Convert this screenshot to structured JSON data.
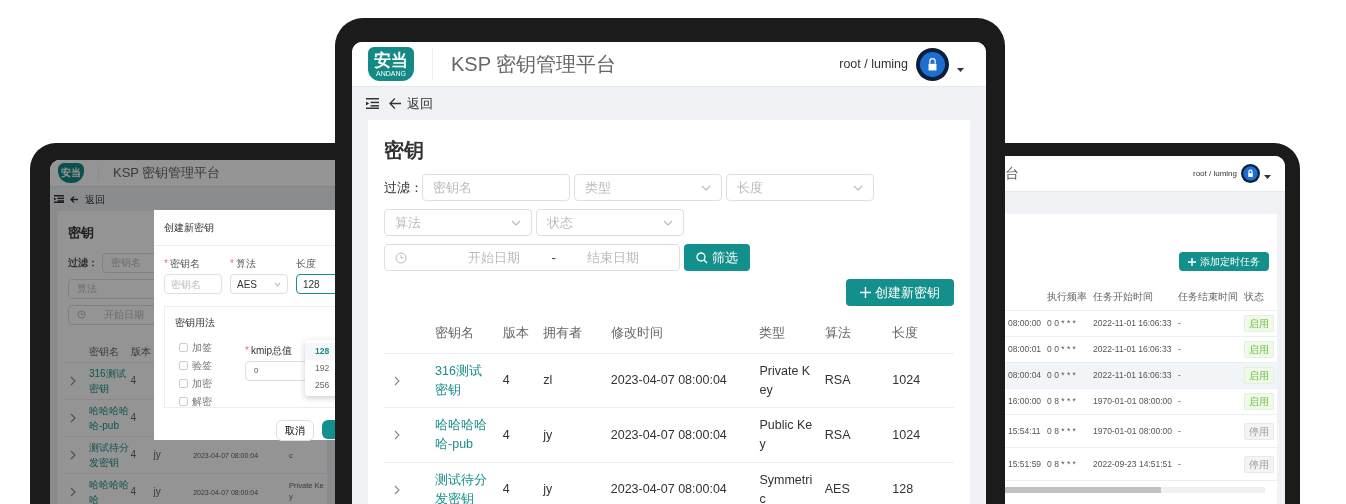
{
  "left_tablet": {
    "logo": "安当",
    "title": "KSP 密钥管理平台",
    "back": "返回",
    "page_title": "密钥",
    "filter_label": "过滤：",
    "name_filter": {
      "placeholder": "密钥名"
    },
    "algorithm_filter": {
      "placeholder": "算法"
    },
    "date_filter": {
      "placeholder": "开始日期"
    },
    "table": {
      "columns": [
        "密钥名",
        "版本"
      ],
      "rows": [
        {
          "name": "316测试密钥",
          "version": "4"
        },
        {
          "name": "哈哈哈哈哈-pub",
          "version": "4"
        },
        {
          "name": "测试待分发密钥",
          "version": "4",
          "owner": "jy",
          "modified": "2023-04-07 08:00:04",
          "type": "c"
        },
        {
          "name": "哈哈哈哈哈",
          "version": "4",
          "owner": "jy",
          "modified": "2023-04-07 08:00:04",
          "type": "Private Key"
        }
      ]
    },
    "dialog": {
      "title": "创建新密钥",
      "fields": [
        {
          "label": "密钥名",
          "required_mark": "*",
          "placeholder": "密钥名"
        },
        {
          "label": "算法",
          "required_mark": "*",
          "value": "AES"
        },
        {
          "label": "长度",
          "value": "128"
        }
      ],
      "length_options": [
        {
          "label": "128",
          "selected": true
        },
        {
          "label": "192",
          "selected": false
        },
        {
          "label": "256",
          "selected": false
        }
      ],
      "usage_title": "密钥用法",
      "usages": [
        {
          "label": "加签",
          "checked": false
        },
        {
          "label": "验签",
          "checked": false
        },
        {
          "label": "加密",
          "checked": false
        },
        {
          "label": "解密",
          "checked": false
        }
      ],
      "kmip": {
        "label": "kmip总值",
        "required_mark": "*",
        "value": "0"
      },
      "cancel": "取消"
    }
  },
  "main_tablet": {
    "logo": "安当",
    "logo_caption": "ANDANG",
    "title": "KSP 密钥管理平台",
    "user": "root / luming",
    "back": "返回",
    "page_title": "密钥",
    "filter_label": "过滤：",
    "filters": [
      {
        "kind": "input",
        "placeholder": "密钥名"
      },
      {
        "kind": "select",
        "placeholder": "类型"
      },
      {
        "kind": "select",
        "placeholder": "长度"
      },
      {
        "kind": "select",
        "placeholder": "算法"
      },
      {
        "kind": "select",
        "placeholder": "状态"
      }
    ],
    "date_range": {
      "start": "开始日期",
      "separator": "-",
      "end": "结束日期"
    },
    "search_button": "筛选",
    "create_button": "创建新密钥",
    "table": {
      "columns": [
        "密钥名",
        "版本",
        "拥有者",
        "修改时间",
        "类型",
        "算法",
        "长度"
      ],
      "rows": [
        {
          "name": "316测试密钥",
          "version": "4",
          "owner": "zl",
          "modified": "2023-04-07 08:00:04",
          "type": "Private Key",
          "algorithm": "RSA",
          "length": "1024"
        },
        {
          "name": "哈哈哈哈哈-pub",
          "version": "4",
          "owner": "jy",
          "modified": "2023-04-07 08:00:04",
          "type": "Public Key",
          "algorithm": "RSA",
          "length": "1024"
        },
        {
          "name": "测试待分发密钥",
          "version": "4",
          "owner": "jy",
          "modified": "2023-04-07 08:00:04",
          "type": "Symmetric",
          "algorithm": "AES",
          "length": "128"
        }
      ]
    }
  },
  "right_tablet": {
    "title": "台",
    "user": "root / luming",
    "add_button": "添加定时任务",
    "table": {
      "columns": [
        "执行频率",
        "任务开始时间",
        "任务结束时间",
        "状态"
      ],
      "rows": [
        {
          "column_1": "08:00:00",
          "frequency": "0 0 * * *",
          "start": "2022-11-01 16:06:33",
          "end": "-",
          "status": "启用",
          "enabled": true,
          "highlighted": false
        },
        {
          "column_1": "08:00:01",
          "frequency": "0 0 * * *",
          "start": "2022-11-01 16:06:33",
          "end": "-",
          "status": "启用",
          "enabled": true,
          "highlighted": false
        },
        {
          "column_1": "08:00:04",
          "frequency": "0 0 * * *",
          "start": "2022-11-01 16:06:33",
          "end": "-",
          "status": "启用",
          "enabled": true,
          "highlighted": true
        },
        {
          "column_1": "16:00:00",
          "frequency": "0 8 * * *",
          "start": "1970-01-01 08:00:00",
          "end": "-",
          "status": "启用",
          "enabled": true,
          "highlighted": false
        },
        {
          "column_1": "15:54:11",
          "frequency": "0 8 * * *",
          "start": "1970-01-01 08:00:00",
          "end": "-",
          "status": "停用",
          "enabled": false,
          "highlighted": false
        },
        {
          "column_1": "15:51:59",
          "frequency": "0 8 * * *",
          "start": "2022-09-23 14:51:51",
          "end": "-",
          "status": "停用",
          "enabled": false,
          "highlighted": false
        }
      ]
    }
  }
}
